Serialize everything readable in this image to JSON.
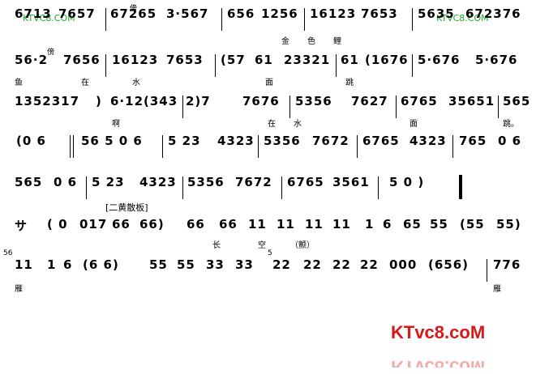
{
  "watermark": "KTVC8.COM",
  "score": {
    "line1": [
      "6713",
      "7657",
      "67265",
      "3·567",
      "656",
      "1256",
      "16123",
      "7653",
      "5635",
      "672376"
    ],
    "line2": [
      "56·2",
      "7656",
      "16123",
      "7653",
      "(57",
      "61",
      "23321",
      "61",
      "(1676",
      "5·676",
      "5·676"
    ],
    "line3": [
      "1352317",
      ")",
      "6·12(343",
      "2)7",
      "7676",
      "5356",
      "7627",
      "6765",
      "35651",
      "565"
    ],
    "line4": [
      "(0 6",
      "56 5 0 6",
      "5 23",
      "4323",
      "5356",
      "7672",
      "6765",
      "4323",
      "765",
      "0 6"
    ],
    "line5": [
      "565",
      "0 6",
      "5 23",
      "4323",
      "5356",
      "7672",
      "6765",
      "3561",
      "5 0 )"
    ],
    "line6": [
      "サ",
      "( 0",
      "017",
      "66",
      "66)",
      "66",
      "66",
      "11",
      "11",
      "11",
      "11",
      "1",
      "6",
      "65",
      "55",
      "(55",
      "55)"
    ],
    "line7": [
      "11",
      "1",
      "6",
      "(6 6)",
      "55",
      "55",
      "33",
      "33",
      "22",
      "22",
      "22",
      "22",
      "000",
      "(656)",
      "776"
    ]
  },
  "lyrics": {
    "line1": [
      "金",
      "色",
      "鲤"
    ],
    "line2": [
      "鱼",
      "在",
      "水",
      "面",
      "跳"
    ],
    "line3": [
      "啊",
      "在",
      "水",
      "面"
    ],
    "line3_end": "跳。",
    "line6": [
      "长",
      "空"
    ],
    "line6_note": "（颤）",
    "line7": [
      "雁",
      "雁"
    ]
  },
  "marks": {
    "line1_marker": "傍",
    "line2_marker": "傍",
    "line7_grace_a": "56",
    "line7_grace_b": "5"
  },
  "section_label": "[二黄散板]",
  "colors": {
    "ink": "#000000",
    "watermark": "#22aa22",
    "logo_red": "#d81818"
  }
}
